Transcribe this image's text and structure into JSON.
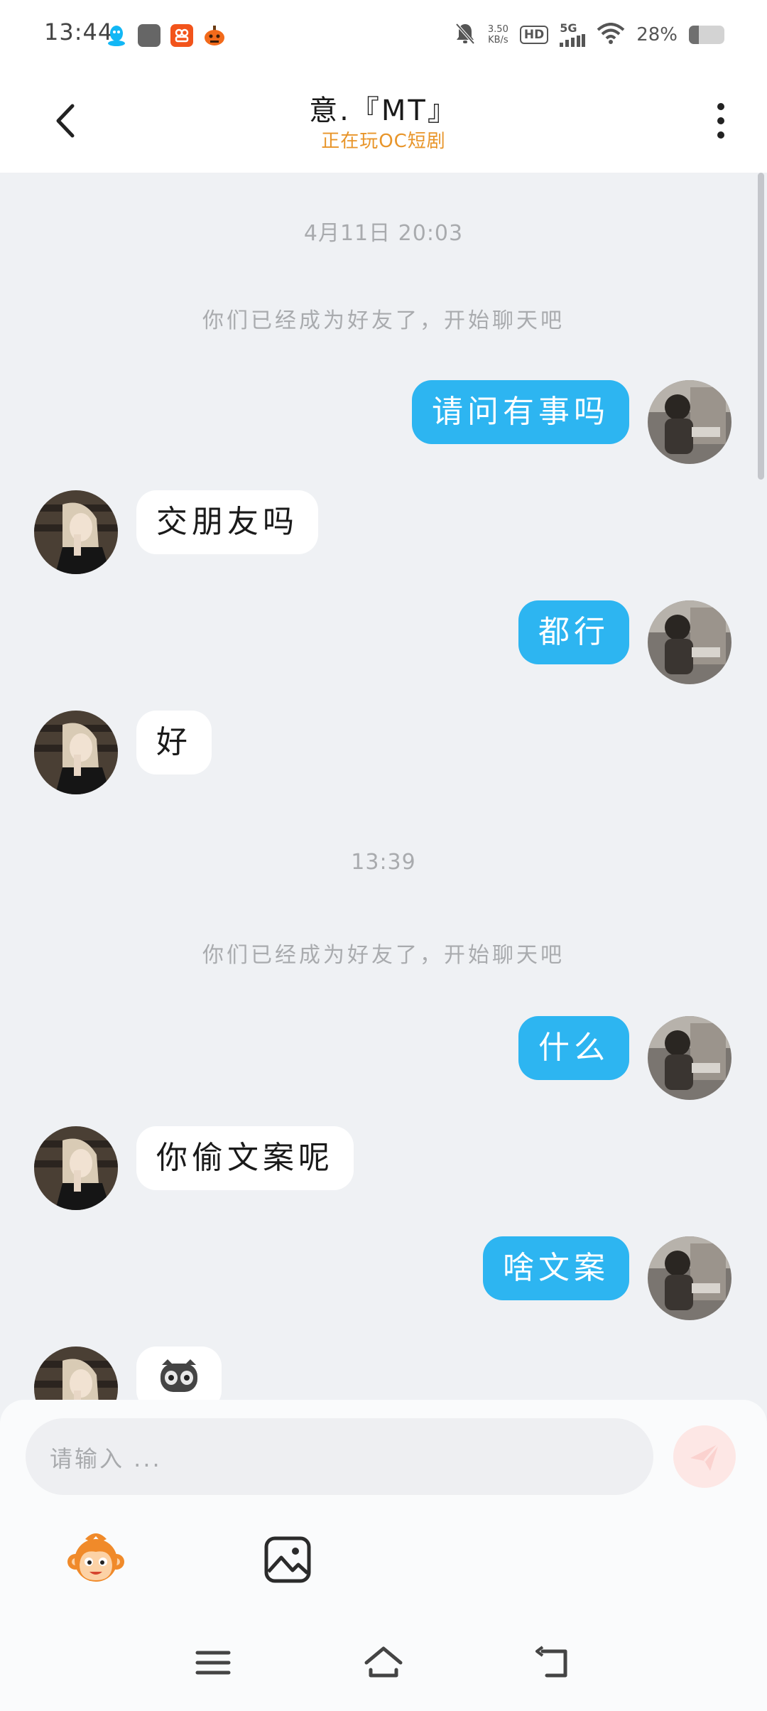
{
  "status_bar": {
    "time": "13:44",
    "app_icons": [
      "qq-icon",
      "square-app-icon",
      "orange-app-icon",
      "pumpkin-app-icon"
    ],
    "net_speed_value": "3.50",
    "net_speed_unit": "KB/s",
    "hd_badge": "HD",
    "network": "5G",
    "battery_text": "28%",
    "battery_level": 0.28
  },
  "header": {
    "title": "意.『MT』",
    "subtitle": "正在玩OC短剧"
  },
  "chat": {
    "timestamps": [
      "4月11日 20:03",
      "13:39"
    ],
    "system_message": "你们已经成为好友了，开始聊天吧",
    "messages": [
      {
        "from": "me",
        "text": "请问有事吗"
      },
      {
        "from": "them",
        "text": "交朋友吗"
      },
      {
        "from": "me",
        "text": "都行"
      },
      {
        "from": "them",
        "text": "好"
      },
      {
        "from": "me",
        "text": "什么"
      },
      {
        "from": "them",
        "text": "你偷文案呢"
      },
      {
        "from": "me",
        "text": "啥文案"
      },
      {
        "from": "them",
        "sticker": "mask-face-sticker"
      }
    ]
  },
  "composer": {
    "placeholder": "请输入 ...",
    "tools": [
      "monkey-sticker-icon",
      "image-icon"
    ]
  },
  "colors": {
    "my_bubble": "#2db5f1",
    "their_bubble": "#ffffff",
    "subtitle": "#e8952a",
    "background": "#eff1f4"
  }
}
